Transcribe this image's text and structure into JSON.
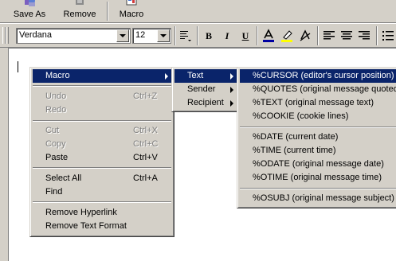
{
  "toolbar": {
    "save_as": "Save As",
    "remove": "Remove",
    "macro": "Macro"
  },
  "format_bar": {
    "font": "Verdana",
    "size": "12",
    "bold": "B",
    "italic": "I",
    "underline": "U"
  },
  "context_menu": {
    "macro": "Macro",
    "undo": "Undo",
    "undo_key": "Ctrl+Z",
    "redo": "Redo",
    "cut": "Cut",
    "cut_key": "Ctrl+X",
    "copy": "Copy",
    "copy_key": "Ctrl+C",
    "paste": "Paste",
    "paste_key": "Ctrl+V",
    "select_all": "Select All",
    "select_all_key": "Ctrl+A",
    "find": "Find",
    "remove_hyperlink": "Remove Hyperlink",
    "remove_text_format": "Remove Text Format"
  },
  "macro_menu": {
    "text": "Text",
    "sender": "Sender",
    "recipient": "Recipient"
  },
  "text_menu": {
    "cursor": "%CURSOR (editor's cursor position)",
    "quotes": "%QUOTES (original message quoted)",
    "text": "%TEXT (original message text)",
    "cookie": "%COOKIE (cookie lines)",
    "date": "%DATE (current date)",
    "time": "%TIME (current time)",
    "odate": "%ODATE (original message date)",
    "otime": "%OTIME (original message time)",
    "osubj": "%OSUBJ (original message subject)"
  }
}
